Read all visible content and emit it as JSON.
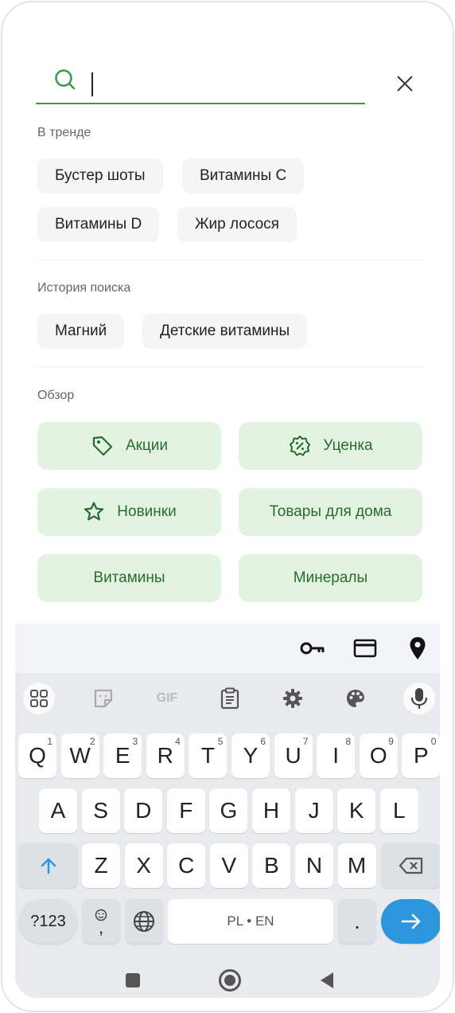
{
  "search": {
    "value": ""
  },
  "sections": {
    "trending": {
      "title": "В тренде",
      "items": [
        "Бустер шоты",
        "Витамины  C",
        "Витамины D",
        "Жир лосося"
      ]
    },
    "history": {
      "title": "История поиска",
      "items": [
        "Магний",
        "Детские витамины"
      ]
    },
    "browse": {
      "title": "Обзор",
      "tiles": [
        {
          "label": "Акции",
          "icon": "tag-icon"
        },
        {
          "label": "Уценка",
          "icon": "discount-badge-icon"
        },
        {
          "label": "Новинки",
          "icon": "star-icon"
        },
        {
          "label": "Товары для дома",
          "icon": ""
        },
        {
          "label": "Витамины",
          "icon": ""
        },
        {
          "label": "Минералы",
          "icon": ""
        }
      ]
    }
  },
  "keyboard": {
    "toolbar_icons": [
      "key-icon",
      "card-icon",
      "location-pin-icon"
    ],
    "top_icons": [
      "apps-grid-icon",
      "sticker-icon",
      "gif-icon",
      "clipboard-icon",
      "settings-gear-icon",
      "palette-icon",
      "microphone-icon"
    ],
    "gif_label": "GIF",
    "row1": [
      "Q",
      "W",
      "E",
      "R",
      "T",
      "Y",
      "U",
      "I",
      "O",
      "P"
    ],
    "row1_digits": [
      "1",
      "2",
      "3",
      "4",
      "5",
      "6",
      "7",
      "8",
      "9",
      "0"
    ],
    "row2": [
      "A",
      "S",
      "D",
      "F",
      "G",
      "H",
      "J",
      "K",
      "L"
    ],
    "row3": [
      "Z",
      "X",
      "C",
      "V",
      "B",
      "N",
      "M"
    ],
    "sym_label": "?123",
    "comma_label": ",",
    "space_label": "PL • EN",
    "period_label": "."
  },
  "colors": {
    "accent": "#3a9a4a",
    "tile_bg": "#e3f3e1",
    "tile_text": "#2a6b2e",
    "enter": "#2e96dc"
  }
}
